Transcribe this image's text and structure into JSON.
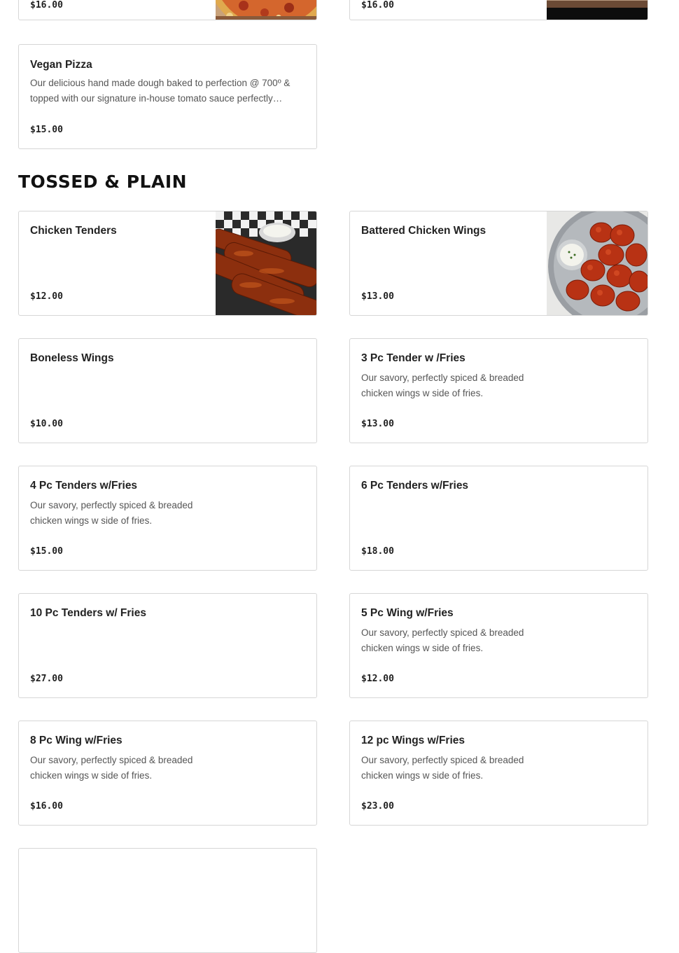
{
  "previous_section": {
    "items": [
      {
        "price": "$16.00"
      },
      {
        "price": "$16.00"
      },
      {
        "name": "Vegan Pizza",
        "description": "Our delicious hand made dough baked to perfection @ 700º & topped with our signature in-house tomato sauce perfectly…",
        "price": "$15.00"
      }
    ]
  },
  "section": {
    "title": "TOSSED & PLAIN",
    "items": [
      {
        "name": "Chicken Tenders",
        "description": "",
        "price": "$12.00",
        "image": "chicken-tenders-photo"
      },
      {
        "name": "Battered Chicken Wings",
        "description": "",
        "price": "$13.00",
        "image": "chicken-wings-photo"
      },
      {
        "name": "Boneless Wings",
        "description": "",
        "price": "$10.00"
      },
      {
        "name": "3 Pc Tender w /Fries",
        "description": "Our savory, perfectly spiced & breaded chicken wings w side of fries.",
        "price": "$13.00"
      },
      {
        "name": "4 Pc Tenders w/Fries",
        "description": "Our savory, perfectly spiced & breaded chicken wings w side of fries.",
        "price": "$15.00"
      },
      {
        "name": "6 Pc Tenders w/Fries",
        "description": "",
        "price": "$18.00"
      },
      {
        "name": "10 Pc Tenders w/ Fries",
        "description": "",
        "price": "$27.00"
      },
      {
        "name": "5 Pc Wing w/Fries",
        "description": "Our savory, perfectly spiced & breaded chicken wings w side of fries.",
        "price": "$12.00"
      },
      {
        "name": "8 Pc Wing w/Fries",
        "description": "Our savory, perfectly spiced & breaded chicken wings w side of fries.",
        "price": "$16.00"
      },
      {
        "name": "12 pc Wings w/Fries",
        "description": "Our savory, perfectly spiced & breaded chicken wings w side of fries.",
        "price": "$23.00"
      }
    ]
  },
  "colors": {
    "card_border": "#d6d6d6",
    "text_primary": "#222222",
    "text_secondary": "#555555",
    "background": "#ffffff"
  }
}
